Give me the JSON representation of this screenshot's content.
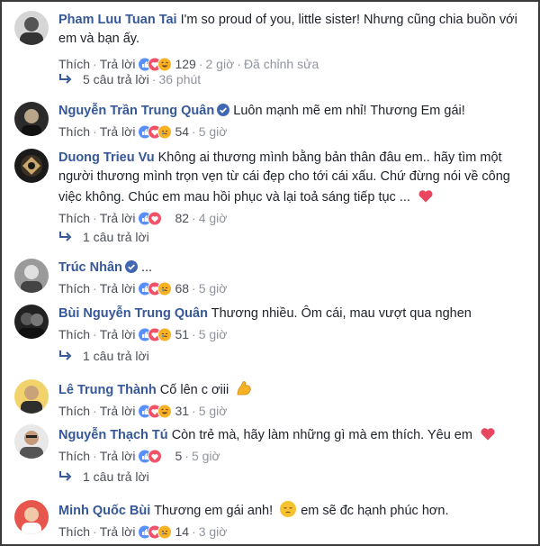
{
  "actions": {
    "like": "Thích",
    "reply": "Trả lời"
  },
  "comments": [
    {
      "name": "Pham Luu Tuan Tai",
      "text": "I'm so proud of you, little sister! Nhưng cũng chia buồn với em và bạn ấy.",
      "reactions": "129",
      "time": "2 giờ",
      "edited": "Đã chỉnh sửa",
      "replies": {
        "count": "5 câu trả lời",
        "time": "36 phút"
      }
    },
    {
      "name": "Nguyễn Trần Trung Quân",
      "text": "Luôn mạnh mẽ em nhỉ! Thương Em gái!",
      "reactions": "54",
      "time": "5 giờ"
    },
    {
      "name": "Duong Trieu Vu",
      "text": "Không ai thương mình bằng bản thân đâu em.. hãy tìm một người thương mình trọn vẹn từ cái đẹp cho tới cái xấu. Chứ đừng nói về công việc không. Chúc em mau hồi phục và lại toả sáng tiếp tục ...",
      "reactions": "82",
      "time": "4 giờ",
      "replies": {
        "count": "1 câu trả lời"
      }
    },
    {
      "name": "Trúc Nhân",
      "text": "...",
      "reactions": "68",
      "time": "5 giờ"
    },
    {
      "name": "Bùi Nguyễn Trung Quân",
      "text": "Thương nhiều. Ôm cái, mau vượt qua nghen",
      "reactions": "51",
      "time": "5 giờ",
      "replies": {
        "count": "1 câu trả lời"
      }
    },
    {
      "name": "Lê Trung Thành",
      "text": "Cố lên c ơiii",
      "reactions": "31",
      "time": "5 giờ"
    },
    {
      "name": "Nguyễn Thạch Tú",
      "text": "Còn trẻ mà, hãy làm những gì mà em thích. Yêu em",
      "reactions": "5",
      "time": "5 giờ",
      "replies": {
        "count": "1 câu trả lời"
      }
    },
    {
      "name": "Minh Quốc Bùi",
      "text": "Thương em gái anh!",
      "text2": "em sẽ đc hạnh phúc hơn.",
      "reactions": "14",
      "time": "3 giờ"
    }
  ],
  "colors": {
    "name": "#365899",
    "meta": "#90949c",
    "like_blue": "#5890ff",
    "love_red": "#f25268",
    "haha_yellow": "#f7b125",
    "heart": "#e8455f"
  },
  "icons": [
    "verified-badge-icon",
    "reply-arrow-icon",
    "like-reaction-icon",
    "love-reaction-icon",
    "haha-reaction-icon",
    "sad-reaction-icon",
    "red-heart-emoji",
    "flexed-biceps-emoji",
    "pensive-face-emoji"
  ]
}
